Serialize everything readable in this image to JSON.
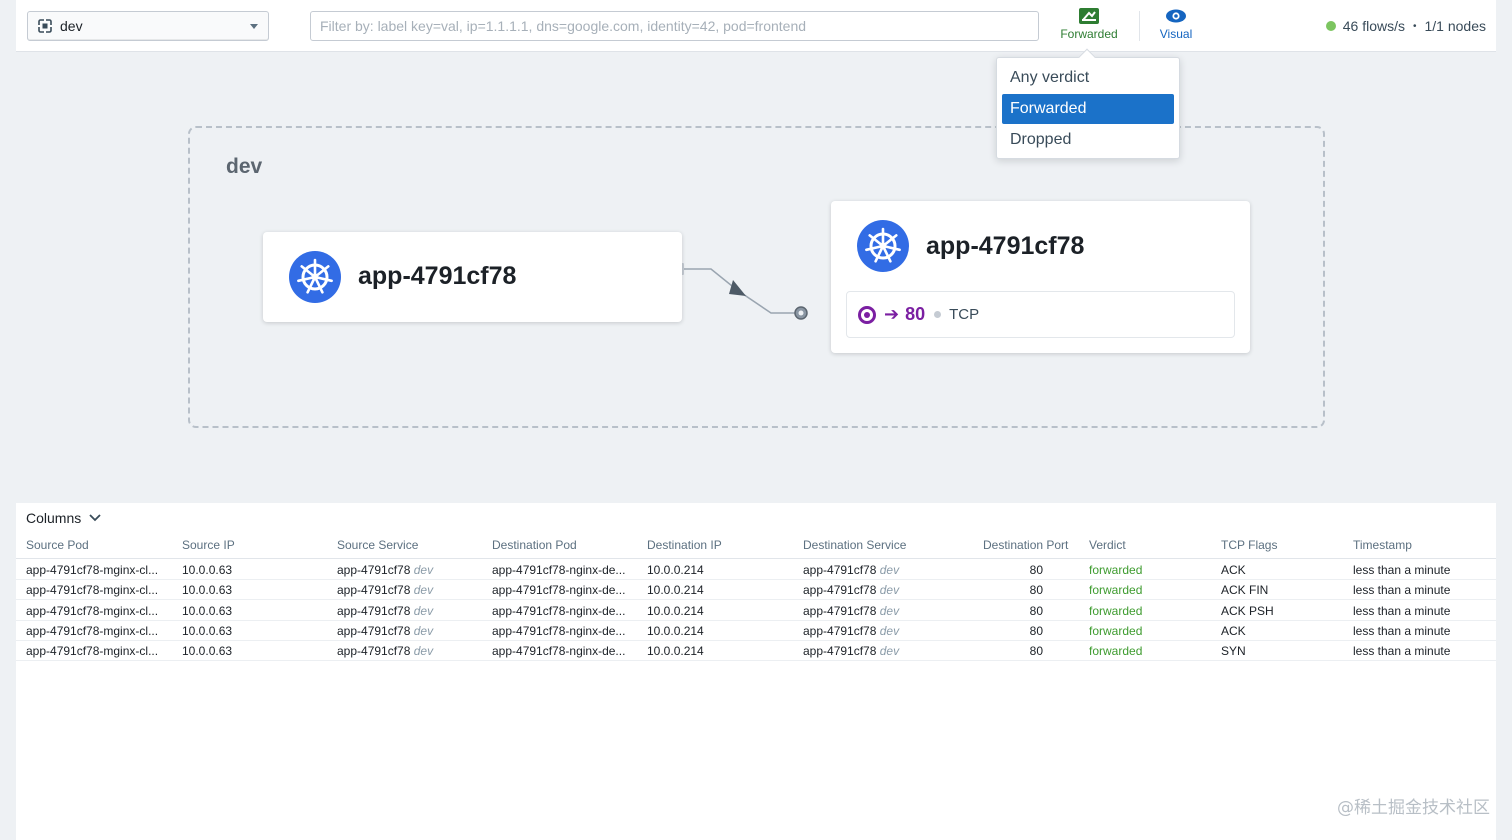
{
  "topbar": {
    "namespace": "dev",
    "filter_placeholder": "Filter by: label key=val, ip=1.1.1.1, dns=google.com, identity=42, pod=frontend",
    "verdict_button": "Forwarded",
    "visual_button": "Visual",
    "flows_rate": "46 flows/s",
    "bullet": "•",
    "nodes": "1/1 nodes"
  },
  "verdict_dropdown": {
    "options": [
      "Any verdict",
      "Forwarded",
      "Dropped"
    ],
    "selected": "Forwarded"
  },
  "map": {
    "namespace_label": "dev",
    "source_card": {
      "title": "app-4791cf78"
    },
    "destination_card": {
      "title": "app-4791cf78",
      "port": "80",
      "protocol": "TCP"
    }
  },
  "table": {
    "columns_button": "Columns",
    "headers": [
      "Source Pod",
      "Source IP",
      "Source Service",
      "Destination Pod",
      "Destination IP",
      "Destination Service",
      "Destination Port",
      "Verdict",
      "TCP Flags",
      "Timestamp"
    ],
    "rows": [
      {
        "source_pod": "app-4791cf78-mginx-cl...",
        "source_ip": "10.0.0.63",
        "source_service": "app-4791cf78",
        "source_ns": "dev",
        "dest_pod": "app-4791cf78-nginx-de...",
        "dest_ip": "10.0.0.214",
        "dest_service": "app-4791cf78",
        "dest_ns": "dev",
        "dest_port": "80",
        "verdict": "forwarded",
        "tcp_flags": "ACK",
        "timestamp": "less than a minute"
      },
      {
        "source_pod": "app-4791cf78-mginx-cl...",
        "source_ip": "10.0.0.63",
        "source_service": "app-4791cf78",
        "source_ns": "dev",
        "dest_pod": "app-4791cf78-nginx-de...",
        "dest_ip": "10.0.0.214",
        "dest_service": "app-4791cf78",
        "dest_ns": "dev",
        "dest_port": "80",
        "verdict": "forwarded",
        "tcp_flags": "ACK FIN",
        "timestamp": "less than a minute"
      },
      {
        "source_pod": "app-4791cf78-mginx-cl...",
        "source_ip": "10.0.0.63",
        "source_service": "app-4791cf78",
        "source_ns": "dev",
        "dest_pod": "app-4791cf78-nginx-de...",
        "dest_ip": "10.0.0.214",
        "dest_service": "app-4791cf78",
        "dest_ns": "dev",
        "dest_port": "80",
        "verdict": "forwarded",
        "tcp_flags": "ACK PSH",
        "timestamp": "less than a minute"
      },
      {
        "source_pod": "app-4791cf78-mginx-cl...",
        "source_ip": "10.0.0.63",
        "source_service": "app-4791cf78",
        "source_ns": "dev",
        "dest_pod": "app-4791cf78-nginx-de...",
        "dest_ip": "10.0.0.214",
        "dest_service": "app-4791cf78",
        "dest_ns": "dev",
        "dest_port": "80",
        "verdict": "forwarded",
        "tcp_flags": "ACK",
        "timestamp": "less than a minute"
      },
      {
        "source_pod": "app-4791cf78-mginx-cl...",
        "source_ip": "10.0.0.63",
        "source_service": "app-4791cf78",
        "source_ns": "dev",
        "dest_pod": "app-4791cf78-nginx-de...",
        "dest_ip": "10.0.0.214",
        "dest_service": "app-4791cf78",
        "dest_ns": "dev",
        "dest_port": "80",
        "verdict": "forwarded",
        "tcp_flags": "SYN",
        "timestamp": "less than a minute"
      }
    ]
  },
  "watermark": "@稀土掘金技术社区",
  "colors": {
    "accent": "#1b72c9",
    "forwarded": "#3d9b2e",
    "kubernetes": "#326ce5",
    "port": "#7b1fa2",
    "status_ok": "#7cc560"
  }
}
